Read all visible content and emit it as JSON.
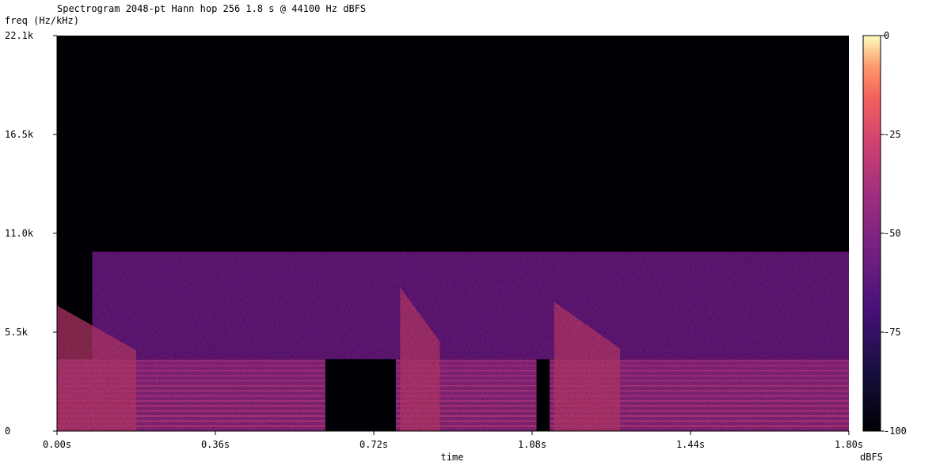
{
  "chart_data": {
    "type": "heatmap",
    "title": "Spectrogram 2048-pt Hann hop 256  1.8 s @ 44100 Hz  dBFS",
    "ylabel": "freq (Hz/kHz)",
    "xlabel": "time",
    "x_unit": "s",
    "y_unit": "Hz",
    "xlim": [
      0,
      1.8
    ],
    "ylim": [
      0,
      22050
    ],
    "x_ticks": [
      0,
      0.36,
      0.72,
      1.08,
      1.44,
      1.8
    ],
    "x_tick_labels": [
      "0.00s",
      "0.36s",
      "0.72s",
      "1.08s",
      "1.44s",
      "1.80s"
    ],
    "y_ticks": [
      0,
      5512,
      11025,
      16538,
      22050
    ],
    "y_tick_labels": [
      "0",
      "5.5k",
      "11.0k",
      "16.5k",
      "22.1k"
    ],
    "colorbar": {
      "label": "dBFS",
      "range": [
        -100,
        0
      ],
      "ticks": [
        0,
        -25,
        -50,
        -75,
        -100
      ],
      "tick_labels": [
        "0",
        "-25",
        "-50",
        "-75",
        "-100"
      ],
      "colormap": "magma"
    },
    "background_db": -100,
    "regions": [
      {
        "name": "broadband-noise",
        "t": [
          0.08,
          1.8
        ],
        "f": [
          4000,
          10000
        ],
        "db": -58
      },
      {
        "name": "tone-1",
        "t": [
          0.0,
          0.61
        ],
        "f": [
          0,
          4000
        ],
        "db": -45,
        "harmonic_spacing_hz": 280
      },
      {
        "name": "tone-2",
        "t": [
          0.77,
          1.09
        ],
        "f": [
          0,
          4000
        ],
        "db": -45,
        "harmonic_spacing_hz": 280
      },
      {
        "name": "tone-3",
        "t": [
          1.12,
          1.8
        ],
        "f": [
          0,
          4000
        ],
        "db": -45,
        "harmonic_spacing_hz": 280
      },
      {
        "name": "gap",
        "t": [
          0.61,
          0.77
        ],
        "f": [
          0,
          4000
        ],
        "db": -100
      }
    ],
    "transients": [
      {
        "t": [
          0.0,
          0.18
        ],
        "f_top_start": 7000,
        "f_top_end": 4500,
        "db": -30
      },
      {
        "t": [
          0.78,
          0.87
        ],
        "f_top_start": 8000,
        "f_top_end": 5000,
        "db": -30
      },
      {
        "t": [
          1.13,
          1.28
        ],
        "f_top_start": 7200,
        "f_top_end": 4600,
        "db": -30
      }
    ]
  }
}
